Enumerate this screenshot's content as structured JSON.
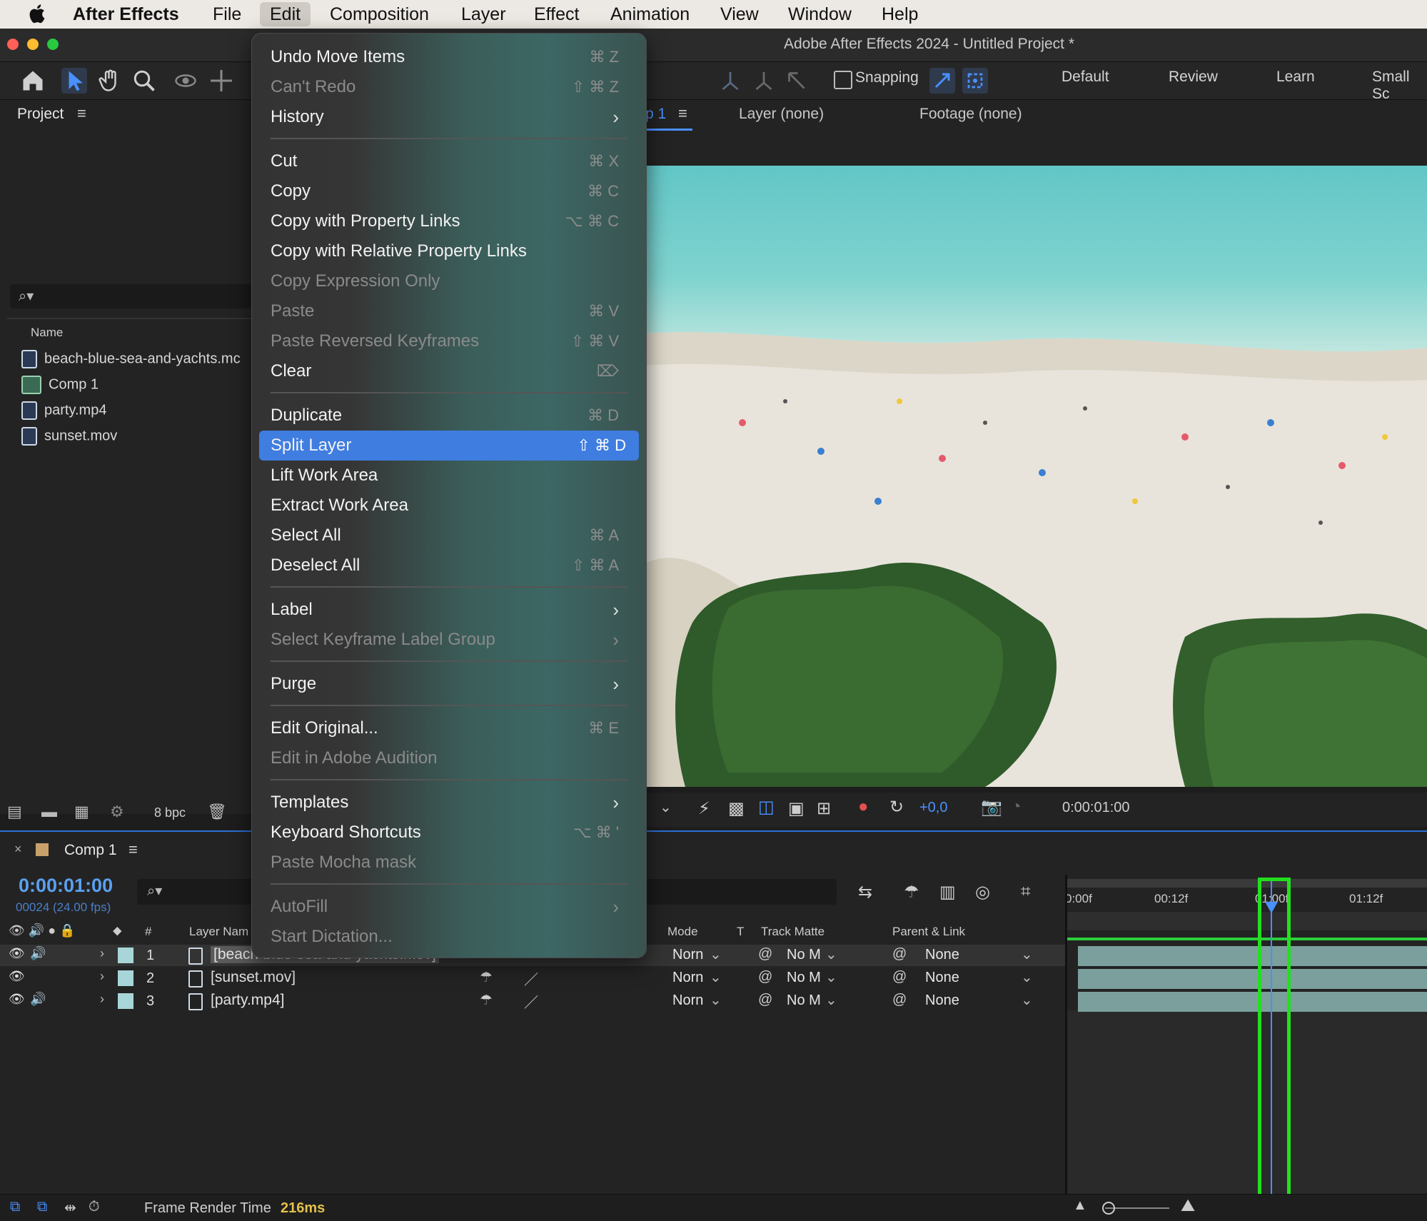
{
  "menubar": {
    "app": "After Effects",
    "items": [
      "File",
      "Edit",
      "Composition",
      "Layer",
      "Effect",
      "Animation",
      "View",
      "Window",
      "Help"
    ]
  },
  "window": {
    "title": "Adobe After Effects 2024 - Untitled Project *"
  },
  "toolbar": {
    "snapping_label": "Snapping",
    "workspaces": [
      "Default",
      "Review",
      "Learn",
      "Small Sc"
    ]
  },
  "project": {
    "title": "Project",
    "column_name": "Name",
    "items": [
      "beach-blue-sea-and-yachts.mc",
      "Comp 1",
      "party.mp4",
      "sunset.mov"
    ],
    "bpc": "8 bpc"
  },
  "viewer": {
    "comp_tab": "p 1",
    "layer_tab": "Layer (none)",
    "footage_tab": "Footage (none)",
    "exposure": "+0,0",
    "timecode": "0:00:01:00"
  },
  "edit_menu": {
    "items": [
      {
        "label": "Undo Move Items",
        "shortcut": "⌘ Z",
        "disabled": false
      },
      {
        "label": "Can't Redo",
        "shortcut": "⇧ ⌘ Z",
        "disabled": true
      },
      {
        "label": "History",
        "shortcut": "",
        "disabled": false,
        "submenu": true
      },
      {
        "label": "Cut",
        "shortcut": "⌘ X",
        "disabled": false
      },
      {
        "label": "Copy",
        "shortcut": "⌘ C",
        "disabled": false
      },
      {
        "label": "Copy with Property Links",
        "shortcut": "⌥ ⌘ C",
        "disabled": false
      },
      {
        "label": "Copy with Relative Property Links",
        "shortcut": "",
        "disabled": false
      },
      {
        "label": "Copy Expression Only",
        "shortcut": "",
        "disabled": true
      },
      {
        "label": "Paste",
        "shortcut": "⌘ V",
        "disabled": true
      },
      {
        "label": "Paste Reversed Keyframes",
        "shortcut": "⇧ ⌘ V",
        "disabled": true
      },
      {
        "label": "Clear",
        "shortcut": "⌦",
        "disabled": false
      },
      {
        "label": "Duplicate",
        "shortcut": "⌘ D",
        "disabled": false
      },
      {
        "label": "Split Layer",
        "shortcut": "⇧ ⌘ D",
        "disabled": false,
        "highlighted": true
      },
      {
        "label": "Lift Work Area",
        "shortcut": "",
        "disabled": false
      },
      {
        "label": "Extract Work Area",
        "shortcut": "",
        "disabled": false
      },
      {
        "label": "Select All",
        "shortcut": "⌘ A",
        "disabled": false
      },
      {
        "label": "Deselect All",
        "shortcut": "⇧ ⌘ A",
        "disabled": false
      },
      {
        "label": "Label",
        "shortcut": "",
        "disabled": false,
        "submenu": true
      },
      {
        "label": "Select Keyframe Label Group",
        "shortcut": "",
        "disabled": true,
        "submenu": true
      },
      {
        "label": "Purge",
        "shortcut": "",
        "disabled": false,
        "submenu": true
      },
      {
        "label": "Edit Original...",
        "shortcut": "⌘ E",
        "disabled": false
      },
      {
        "label": "Edit in Adobe Audition",
        "shortcut": "",
        "disabled": true
      },
      {
        "label": "Templates",
        "shortcut": "",
        "disabled": false,
        "submenu": true
      },
      {
        "label": "Keyboard Shortcuts",
        "shortcut": "⌥ ⌘ '",
        "disabled": false
      },
      {
        "label": "Paste Mocha mask",
        "shortcut": "",
        "disabled": true
      },
      {
        "label": "AutoFill",
        "shortcut": "",
        "disabled": true,
        "submenu": true
      },
      {
        "label": "Start Dictation...",
        "shortcut": "",
        "disabled": true
      }
    ]
  },
  "timeline": {
    "comp_tab": "Comp 1",
    "timecode": "0:00:01:00",
    "frames": "00024 (24.00 fps)",
    "columns": {
      "num": "#",
      "layer_name": "Layer Nam",
      "mode": "Mode",
      "t": "T",
      "track_matte": "Track Matte",
      "parent": "Parent & Link"
    },
    "ruler": [
      "0:00f",
      "00:12f",
      "01:00f",
      "01:12f"
    ],
    "layers": [
      {
        "num": "1",
        "name": "[beach-blue-sea-and-yachts.mov]",
        "mode": "Norn",
        "matte": "No M",
        "parent": "None"
      },
      {
        "num": "2",
        "name": "[sunset.mov]",
        "mode": "Norn",
        "matte": "No M",
        "parent": "None"
      },
      {
        "num": "3",
        "name": "[party.mp4]",
        "mode": "Norn",
        "matte": "No M",
        "parent": "None"
      }
    ]
  },
  "status": {
    "label": "Frame Render Time",
    "value": "216ms"
  },
  "colors": {
    "accent": "#3f7de0",
    "highlight_box": "#22e01e",
    "timecode": "#5aa0f0"
  }
}
